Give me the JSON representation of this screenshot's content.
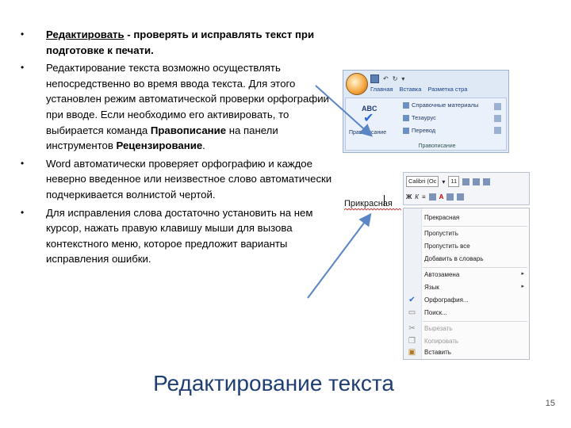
{
  "bullets": {
    "b1_underlined": "Редактировать",
    "b1_rest": " - проверять и исправлять текст при подготовке к печати.",
    "b2_text": "Редактирование текста возможно  осуществлять непосредственно во время ввода текста. Для этого установлен режим автоматической проверки орфографии при вводе. Если необходимо его активировать, то выбирается команда ",
    "b2_bold1": "Правописание",
    "b2_mid": " на панели инструментов ",
    "b2_bold2": "Рецензирование",
    "b2_end": ".",
    "b3_text": "Word автоматически проверяет орфографию и каждое неверно введенное или неизвестное слово автоматически подчеркивается волнистой чертой.",
    "b4_text": "Для исправления слова достаточно установить на нем курсор, нажать правую клавишу мыши для вызова контекстного меню, которое предложит варианты исправления ошибки."
  },
  "ribbon": {
    "tabs": [
      "Главная",
      "Вставка",
      "Разметка стра"
    ],
    "abc": "ABC",
    "spelling": "Правописание",
    "items": [
      "Справочные материалы",
      "Тезаурус",
      "Перевод"
    ],
    "group_label": "Правописание"
  },
  "minibar": {
    "font": "Calibri (Ос",
    "size": "11"
  },
  "misspelled_word": "Прикрасная",
  "context_menu": {
    "items": [
      "Прекрасная",
      "Пропустить",
      "Пропустить все",
      "Добавить в словарь",
      "Автозамена",
      "Язык",
      "Орфография...",
      "Поиск...",
      "Вырезать",
      "Копировать",
      "Вставить"
    ]
  },
  "slide_title": "Редактирование текста",
  "page_number": "15",
  "colors": {
    "title": "#1f3f73",
    "arrow": "#5b86c5",
    "wave": "#d62020"
  }
}
